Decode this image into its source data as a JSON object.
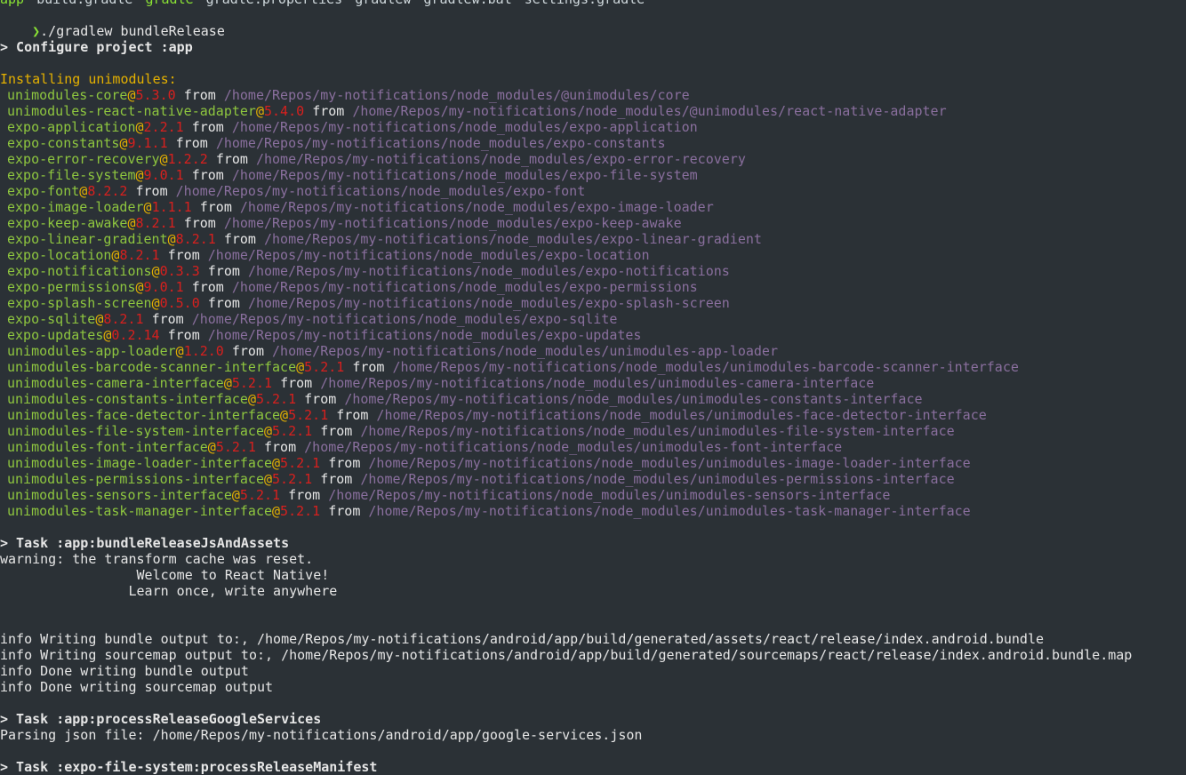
{
  "top_files": [
    "app",
    "build.gradle",
    "gradle",
    "gradle.properties",
    "gradlew",
    "gradlew.bat",
    "settings.gradle"
  ],
  "prompt_symbol": "❯",
  "command": "./gradlew bundleRelease",
  "configure_header": "> Configure project :app",
  "installing_header": "Installing unimodules:",
  "from_word": "from",
  "unimodules": [
    {
      "name": "unimodules-core",
      "version": "5.3.0",
      "path": "/home/Repos/my-notifications/node_modules/@unimodules/core"
    },
    {
      "name": "unimodules-react-native-adapter",
      "version": "5.4.0",
      "path": "/home/Repos/my-notifications/node_modules/@unimodules/react-native-adapter"
    },
    {
      "name": "expo-application",
      "version": "2.2.1",
      "path": "/home/Repos/my-notifications/node_modules/expo-application"
    },
    {
      "name": "expo-constants",
      "version": "9.1.1",
      "path": "/home/Repos/my-notifications/node_modules/expo-constants"
    },
    {
      "name": "expo-error-recovery",
      "version": "1.2.2",
      "path": "/home/Repos/my-notifications/node_modules/expo-error-recovery"
    },
    {
      "name": "expo-file-system",
      "version": "9.0.1",
      "path": "/home/Repos/my-notifications/node_modules/expo-file-system"
    },
    {
      "name": "expo-font",
      "version": "8.2.2",
      "path": "/home/Repos/my-notifications/node_modules/expo-font"
    },
    {
      "name": "expo-image-loader",
      "version": "1.1.1",
      "path": "/home/Repos/my-notifications/node_modules/expo-image-loader"
    },
    {
      "name": "expo-keep-awake",
      "version": "8.2.1",
      "path": "/home/Repos/my-notifications/node_modules/expo-keep-awake"
    },
    {
      "name": "expo-linear-gradient",
      "version": "8.2.1",
      "path": "/home/Repos/my-notifications/node_modules/expo-linear-gradient"
    },
    {
      "name": "expo-location",
      "version": "8.2.1",
      "path": "/home/Repos/my-notifications/node_modules/expo-location"
    },
    {
      "name": "expo-notifications",
      "version": "0.3.3",
      "path": "/home/Repos/my-notifications/node_modules/expo-notifications"
    },
    {
      "name": "expo-permissions",
      "version": "9.0.1",
      "path": "/home/Repos/my-notifications/node_modules/expo-permissions"
    },
    {
      "name": "expo-splash-screen",
      "version": "0.5.0",
      "path": "/home/Repos/my-notifications/node_modules/expo-splash-screen"
    },
    {
      "name": "expo-sqlite",
      "version": "8.2.1",
      "path": "/home/Repos/my-notifications/node_modules/expo-sqlite"
    },
    {
      "name": "expo-updates",
      "version": "0.2.14",
      "path": "/home/Repos/my-notifications/node_modules/expo-updates"
    },
    {
      "name": "unimodules-app-loader",
      "version": "1.2.0",
      "path": "/home/Repos/my-notifications/node_modules/unimodules-app-loader"
    },
    {
      "name": "unimodules-barcode-scanner-interface",
      "version": "5.2.1",
      "path": "/home/Repos/my-notifications/node_modules/unimodules-barcode-scanner-interface"
    },
    {
      "name": "unimodules-camera-interface",
      "version": "5.2.1",
      "path": "/home/Repos/my-notifications/node_modules/unimodules-camera-interface"
    },
    {
      "name": "unimodules-constants-interface",
      "version": "5.2.1",
      "path": "/home/Repos/my-notifications/node_modules/unimodules-constants-interface"
    },
    {
      "name": "unimodules-face-detector-interface",
      "version": "5.2.1",
      "path": "/home/Repos/my-notifications/node_modules/unimodules-face-detector-interface"
    },
    {
      "name": "unimodules-file-system-interface",
      "version": "5.2.1",
      "path": "/home/Repos/my-notifications/node_modules/unimodules-file-system-interface"
    },
    {
      "name": "unimodules-font-interface",
      "version": "5.2.1",
      "path": "/home/Repos/my-notifications/node_modules/unimodules-font-interface"
    },
    {
      "name": "unimodules-image-loader-interface",
      "version": "5.2.1",
      "path": "/home/Repos/my-notifications/node_modules/unimodules-image-loader-interface"
    },
    {
      "name": "unimodules-permissions-interface",
      "version": "5.2.1",
      "path": "/home/Repos/my-notifications/node_modules/unimodules-permissions-interface"
    },
    {
      "name": "unimodules-sensors-interface",
      "version": "5.2.1",
      "path": "/home/Repos/my-notifications/node_modules/unimodules-sensors-interface"
    },
    {
      "name": "unimodules-task-manager-interface",
      "version": "5.2.1",
      "path": "/home/Repos/my-notifications/node_modules/unimodules-task-manager-interface"
    }
  ],
  "task1_header": "> Task :app:bundleReleaseJsAndAssets",
  "warning_line": "warning: the transform cache was reset.",
  "welcome_line": "                 Welcome to React Native!",
  "learn_line": "                Learn once, write anywhere",
  "info_lines": [
    "info Writing bundle output to:, /home/Repos/my-notifications/android/app/build/generated/assets/react/release/index.android.bundle",
    "info Writing sourcemap output to:, /home/Repos/my-notifications/android/app/build/generated/sourcemaps/react/release/index.android.bundle.map",
    "info Done writing bundle output",
    "info Done writing sourcemap output"
  ],
  "task2_header": "> Task :app:processReleaseGoogleServices",
  "parsing_line": "Parsing json file: /home/Repos/my-notifications/android/app/google-services.json",
  "task3_header": "> Task :expo-file-system:processReleaseManifest",
  "colors": {
    "background": "#2b3136",
    "package": "#8ec63f",
    "version": "#d8201e",
    "path": "#8a6f9e",
    "header_yellow": "#e5b100",
    "prompt": "#8ae234"
  }
}
